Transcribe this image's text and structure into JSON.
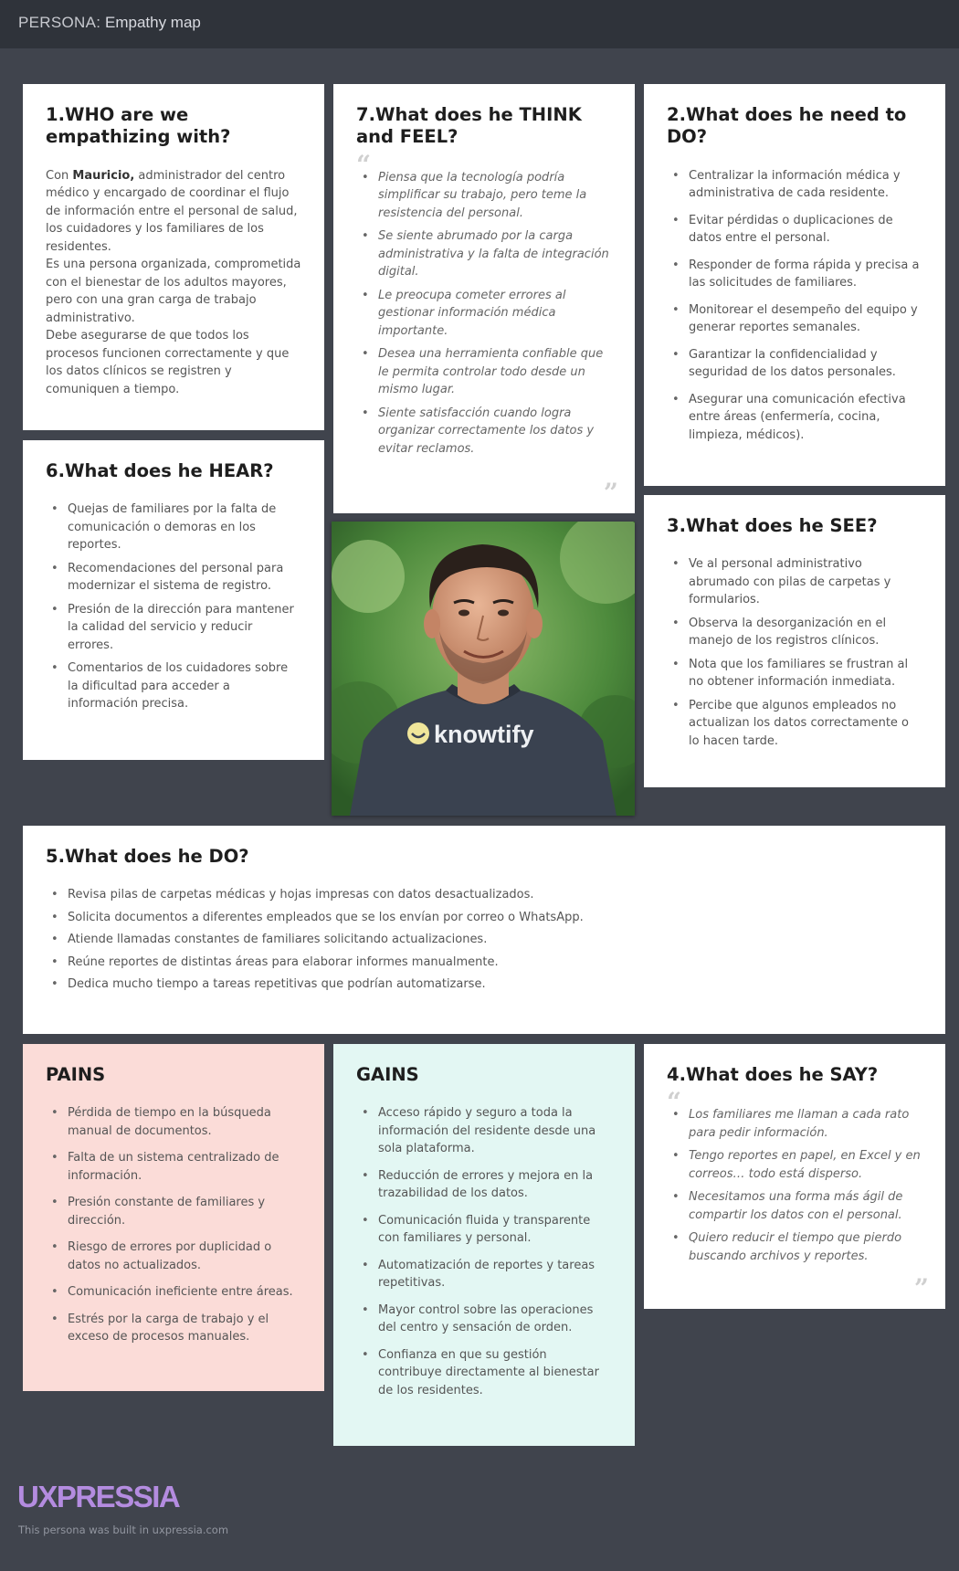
{
  "header": {
    "prefix": "PERSONA:",
    "title": "Empathy map"
  },
  "who": {
    "title": "1.WHO are we empathizing with?",
    "lead": "Con ",
    "name": "Mauricio,",
    "p1": " administrador del centro médico y encargado de coordinar el flujo de información entre el personal de salud, los cuidadores y los familiares de los residentes.",
    "p2": "Es una persona organizada, comprometida con el bienestar de los adultos mayores, pero con una gran carga de trabajo administrativo.",
    "p3": "Debe asegurarse de que todos los procesos funcionen correctamente y que los datos clínicos se registren y comuniquen a tiempo."
  },
  "think": {
    "title": "7.What does he THINK and FEEL?",
    "open_quote": "“",
    "close_quote": "”",
    "items": [
      "Piensa que la tecnología podría simplificar su trabajo, pero teme la resistencia del personal.",
      "Se siente abrumado por la carga administrativa y la falta de integración digital.",
      "Le preocupa cometer errores al gestionar información médica importante.",
      "Desea una herramienta confiable que le permita controlar todo desde un mismo lugar.",
      "Siente satisfacción cuando logra organizar correctamente los datos y evitar reclamos."
    ]
  },
  "need": {
    "title": "2.What does he need to DO?",
    "items": [
      "Centralizar la información médica y administrativa de cada residente.",
      "Evitar pérdidas o duplicaciones de datos entre el personal.",
      "Responder de forma rápida y precisa a las solicitudes de familiares.",
      "Monitorear el desempeño del equipo y generar reportes semanales.",
      "Garantizar la confidencialidad y seguridad de los datos personales.",
      "Asegurar una comunicación efectiva entre áreas (enfermería, cocina, limpieza, médicos)."
    ]
  },
  "hear": {
    "title": "6.What does he HEAR?",
    "items": [
      "Quejas de familiares por la falta de comunicación o demoras en los reportes.",
      "Recomendaciones del personal para modernizar el sistema de registro.",
      "Presión de la dirección para mantener la calidad del servicio y reducir errores.",
      "Comentarios de los cuidadores sobre la dificultad para acceder a información precisa."
    ]
  },
  "photo": {
    "shirt_text": "knowtify"
  },
  "see": {
    "title": "3.What does he SEE?",
    "items": [
      "Ve al personal administrativo abrumado con pilas de carpetas y formularios.",
      "Observa la desorganización en el manejo de los registros clínicos.",
      "Nota que los familiares se frustran al no obtener información inmediata.",
      "Percibe que algunos empleados no actualizan los datos correctamente o lo hacen tarde."
    ]
  },
  "does": {
    "title": "5.What does he DO?",
    "items": [
      "Revisa pilas de carpetas médicas y hojas impresas con datos desactualizados.",
      "Solicita documentos a diferentes empleados que se los envían por correo o WhatsApp.",
      "Atiende llamadas constantes de familiares solicitando actualizaciones.",
      "Reúne reportes de distintas áreas para elaborar informes manualmente.",
      "Dedica mucho tiempo a tareas repetitivas que podrían automatizarse."
    ]
  },
  "pains": {
    "title": "PAINS",
    "color": "#fbdcd8",
    "items": [
      "Pérdida de tiempo en la búsqueda manual de documentos.",
      "Falta de un sistema centralizado de información.",
      "Presión constante de familiares y dirección.",
      "Riesgo de errores por duplicidad o datos no actualizados.",
      "Comunicación ineficiente entre áreas.",
      "Estrés por la carga de trabajo y el exceso de procesos manuales."
    ]
  },
  "gains": {
    "title": "GAINS",
    "color": "#e3f7f3",
    "items": [
      "Acceso rápido y seguro a toda la información del residente desde una sola plataforma.",
      "Reducción de errores y mejora en la trazabilidad de los datos.",
      "Comunicación fluida y transparente con familiares y personal.",
      "Automatización de reportes y tareas repetitivas.",
      "Mayor control sobre las operaciones del centro y sensación de orden.",
      "Confianza en que su gestión contribuye directamente al bienestar de los residentes."
    ]
  },
  "say": {
    "title": "4.What does he SAY?",
    "open_quote": "“",
    "close_quote": "”",
    "items": [
      "Los familiares me llaman a cada rato para pedir información.",
      "Tengo reportes en papel, en Excel y en correos… todo está disperso.",
      "Necesitamos una forma más ágil de compartir los datos con el personal.",
      "Quiero reducir el tiempo que pierdo buscando archivos y reportes."
    ]
  },
  "footer": {
    "logo": "UXPRESSIA",
    "note": "This persona was built in uxpressia.com"
  }
}
